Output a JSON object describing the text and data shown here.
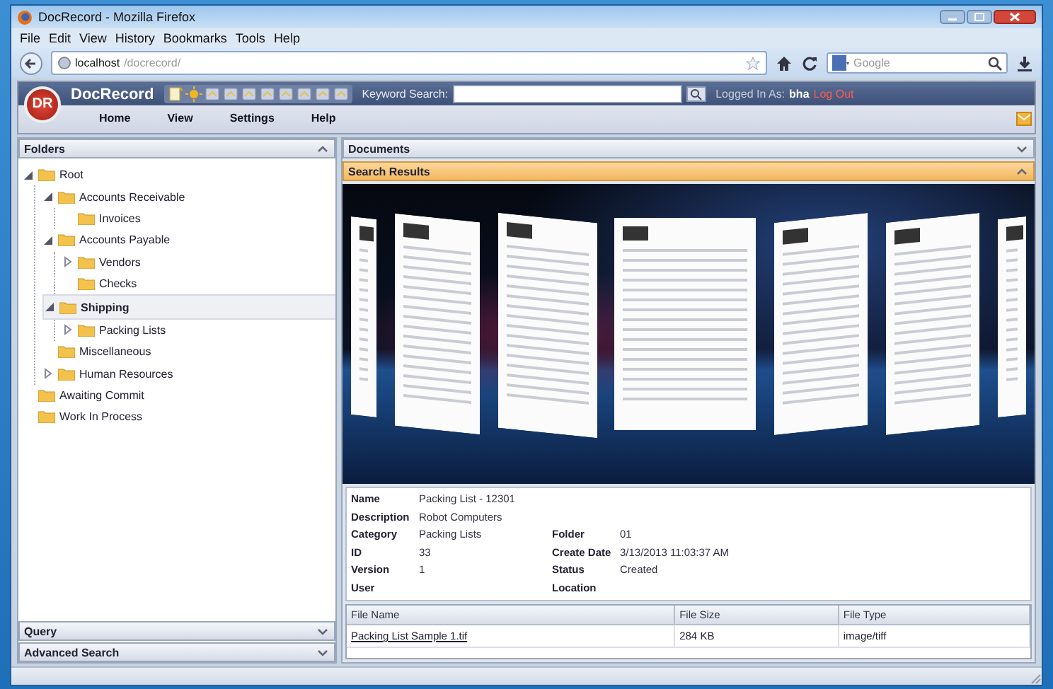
{
  "window": {
    "title": "DocRecord - Mozilla Firefox"
  },
  "menu": [
    "File",
    "Edit",
    "View",
    "History",
    "Bookmarks",
    "Tools",
    "Help"
  ],
  "address": {
    "host": "localhost",
    "path": "/docrecord/"
  },
  "web_search": {
    "placeholder": "Google"
  },
  "app": {
    "logo": "DR",
    "name": "DocRecord",
    "keyword_label": "Keyword Search:",
    "logged_in_label": "Logged In As:",
    "user": "bha",
    "logout": "Log Out",
    "nav": [
      "Home",
      "View",
      "Settings",
      "Help"
    ]
  },
  "folders": {
    "title": "Folders",
    "expanded": true,
    "tree": [
      {
        "label": "Root",
        "expanded": true,
        "selected": false,
        "children": [
          {
            "label": "Accounts Receivable",
            "expanded": true,
            "selected": false,
            "children": [
              {
                "label": "Invoices",
                "selected": false
              }
            ]
          },
          {
            "label": "Accounts Payable",
            "expanded": true,
            "selected": false,
            "children": [
              {
                "label": "Vendors",
                "expanded": false,
                "selected": false
              },
              {
                "label": "Checks",
                "selected": false
              }
            ]
          },
          {
            "label": "Shipping",
            "expanded": true,
            "selected": true,
            "children": [
              {
                "label": "Packing Lists",
                "expanded": false,
                "selected": false
              }
            ]
          },
          {
            "label": "Miscellaneous",
            "selected": false
          },
          {
            "label": "Human Resources",
            "expanded": false,
            "selected": false
          }
        ]
      },
      {
        "label": "Awaiting Commit",
        "selected": false
      },
      {
        "label": "Work In Process",
        "selected": false
      }
    ]
  },
  "left_sections": [
    {
      "label": "Query",
      "expanded": false
    },
    {
      "label": "Advanced Search",
      "expanded": false
    }
  ],
  "right_sections": [
    {
      "label": "Documents",
      "expanded": false,
      "selected": false
    },
    {
      "label": "Search Results",
      "expanded": true,
      "selected": true
    }
  ],
  "details": [
    [
      {
        "label": "Name",
        "value": "Packing List - 12301"
      }
    ],
    [
      {
        "label": "Description",
        "value": "Robot Computers"
      }
    ],
    [
      {
        "label": "Category",
        "value": "Packing Lists"
      },
      {
        "label": "Folder",
        "value": "01"
      }
    ],
    [
      {
        "label": "ID",
        "value": "33"
      },
      {
        "label": "Create Date",
        "value": "3/13/2013 11:03:37 AM"
      }
    ],
    [
      {
        "label": "Version",
        "value": "1"
      },
      {
        "label": "Status",
        "value": "Created"
      }
    ],
    [
      {
        "label": "User"
      },
      {
        "label": "Location"
      }
    ]
  ],
  "files": {
    "columns": [
      "File Name",
      "File Size",
      "File Type"
    ],
    "rows": [
      [
        "Packing List Sample 1.tif",
        "284 KB",
        "image/tiff"
      ]
    ]
  }
}
